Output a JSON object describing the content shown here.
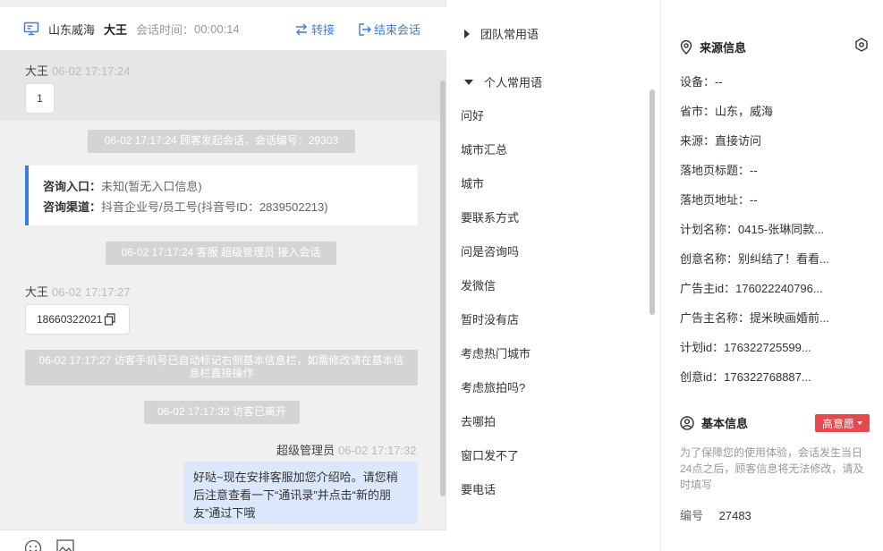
{
  "chat": {
    "header": {
      "region": "山东威海",
      "visitor_name": "大王",
      "session_time_label": "会话时间：",
      "session_time": "00:00:14",
      "transfer_label": "转接",
      "end_label": "结束会话"
    },
    "messages": {
      "m1_sender": "大王",
      "m1_time": "06-02 17:17:24",
      "m1_text": "1",
      "sys1": "06-02 17:17:24 顾客发起会话，会话编号：29303",
      "card_entry_label": "咨询入口：",
      "card_entry_value": "未知(暂无入口信息)",
      "card_channel_label": "咨询渠道：",
      "card_channel_value": "抖音企业号/员工号(抖音号ID：2839502213)",
      "sys2": "06-02 17:17:24 客服 超级管理员 接入会话",
      "m2_sender": "大王",
      "m2_time": "06-02 17:17:27",
      "m2_text": "18660322021",
      "sys3": "06-02 17:17:27 访客手机号已自动标记右侧基本信息栏，如需修改请在基本信息栏直接操作",
      "sys4": "06-02 17:17:32 访客已离开",
      "m3_sender": "超级管理员",
      "m3_time": "06-02 17:17:32",
      "m3_text": "好哒~现在安排客服加您介绍哈。请您稍后注意查看一下“通讯录”并点击“新的朋友”通过下哦"
    }
  },
  "phrases": {
    "team_title": "团队常用语",
    "personal_title": "个人常用语",
    "items": [
      "问好",
      "城市汇总",
      "城市",
      "要联系方式",
      "问是咨询吗",
      "发微信",
      "暂时没有店",
      "考虑热门城市",
      "考虑旅拍吗?",
      "去哪拍",
      "窗口发不了",
      "要电话"
    ]
  },
  "info": {
    "source_title": "来源信息",
    "fields": [
      "设备：--",
      "省市：山东，威海",
      "来源：直接访问",
      "落地页标题：--",
      "落地页地址：--",
      "计划名称：0415-张琳同款...",
      "创意名称：别纠结了！看看...",
      "广告主id：176022240796...",
      "广告主名称：提米映画婚前...",
      "计划id：176322725599...",
      "创意id：176322768887..."
    ],
    "basic_title": "基本信息",
    "intent_badge": "高意愿",
    "notice": "为了保障您的使用体验，会话发生当日24点之后，顾客信息将无法修改，请及时填写",
    "id_label": "编号",
    "id_value": "27483"
  },
  "colors": {
    "accent": "#3a7de0",
    "badge": "#e5484d",
    "own_bubble": "#dbe8fb"
  }
}
